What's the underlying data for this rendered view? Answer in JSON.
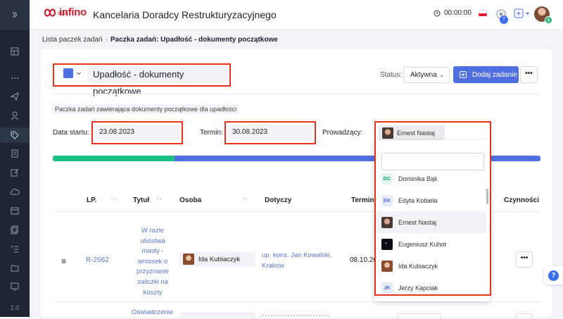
{
  "app": {
    "logo_text": "infino",
    "logo_subtext": "legal",
    "title": "Kancelaria Doradcy Restrukturyzacyjnego",
    "timer": "00:00:00",
    "notification_count": "7",
    "user_badge": "5"
  },
  "breadcrumb": {
    "parent": "Lista paczek zadań",
    "separator": "›",
    "current": "Paczka zadań: Upadłość - dokumenty początkowe"
  },
  "package": {
    "title": "Upadłość - dokumenty początkowe",
    "color": "#4f6fe0",
    "description": "Paczka zadań zawierająca dokumenty początkowe dla upadłości",
    "status_label": "Status:",
    "status_value": "Aktywna",
    "add_task_label": "Dodaj zadanie",
    "more_label": "•••",
    "start_label": "Data startu:",
    "start_value": "23.08.2023",
    "term_label": "Termin:",
    "term_value": "30.08.2023",
    "lead_label": "Prowadzący:",
    "lead_value": "Ernest Nastaj",
    "progress_done_fraction": 0.25
  },
  "table": {
    "headers": {
      "lp": "LP.",
      "title": "Tytuł",
      "person": "Osoba",
      "concerns": "Dotyczy",
      "term": "Termin",
      "actions": "Czynności"
    },
    "rows": [
      {
        "id": "R-2662",
        "title_lines": [
          "W razie",
          "ubóstwa",
          "masty -",
          "wniosek o",
          "przyznanie",
          "zaliczki na",
          "koszty"
        ],
        "person": "Ida Kubiaczyk",
        "concerns_lines": [
          "up. kons. Jan Kowalski,",
          "Kraków"
        ],
        "term": "08.10.20",
        "more": "•••"
      },
      {
        "title_partial": "Oświadczenie"
      }
    ]
  },
  "lead_dropdown": {
    "search_placeholder": "",
    "options": [
      {
        "initials": "DC",
        "name": "Dominika Bąk",
        "avatar": "initials-green"
      },
      {
        "initials": "EK",
        "name": "Edyta Kobiela",
        "avatar": "initials-blue"
      },
      {
        "initials": "",
        "name": "Ernest Nastaj",
        "avatar": "photo"
      },
      {
        "initials": "",
        "name": "Eugeniusz Kuhot",
        "avatar": "photo-dark"
      },
      {
        "initials": "",
        "name": "Ida Kubiaczyk",
        "avatar": "photo"
      },
      {
        "initials": "JK",
        "name": "Jerzy Kapciak",
        "avatar": "initials-blue"
      }
    ],
    "highlighted_index": 2
  },
  "sidebar": {
    "version": "1.0",
    "icons": [
      "expand-icon",
      "dashboard-icon",
      "more-icon",
      "send-icon",
      "users-icon",
      "tag-icon",
      "document-icon",
      "edit-icon",
      "cloud-icon",
      "calendar-icon",
      "files-icon",
      "checklist-icon",
      "folder-icon",
      "monitor-icon"
    ]
  },
  "colors": {
    "accent": "#4f6fe0",
    "progress_done": "#1bbf84",
    "highlight_outline": "#e8331c",
    "sidebar_bg": "#1f2533"
  }
}
